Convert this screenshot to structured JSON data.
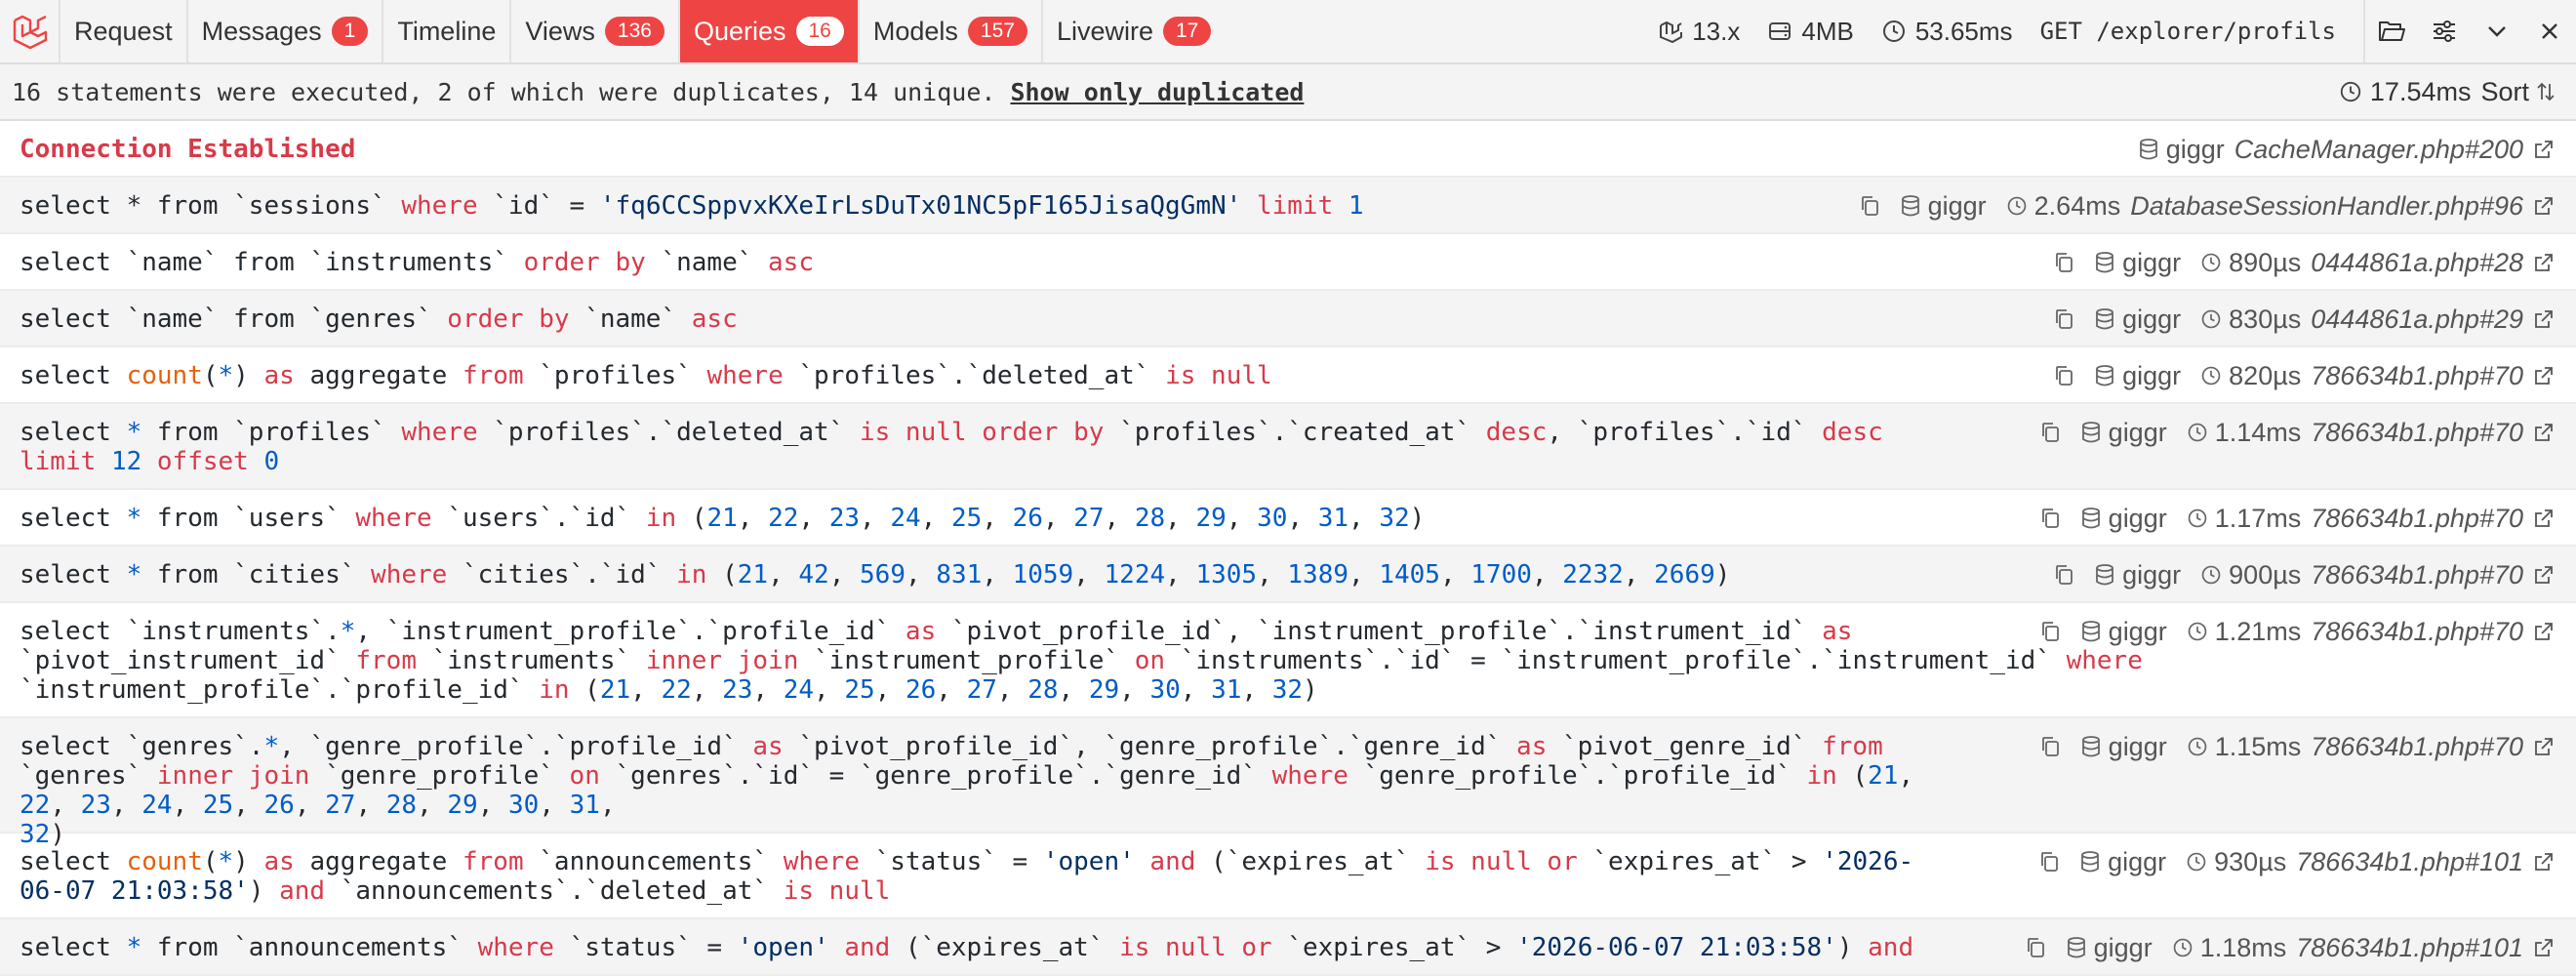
{
  "toolbar": {
    "tabs": [
      {
        "label": "Request"
      },
      {
        "label": "Messages",
        "badge": "1"
      },
      {
        "label": "Timeline"
      },
      {
        "label": "Views",
        "badge": "136"
      },
      {
        "label": "Queries",
        "badge": "16",
        "active": true
      },
      {
        "label": "Models",
        "badge": "157"
      },
      {
        "label": "Livewire",
        "badge": "17"
      }
    ],
    "laravel_version": "13.x",
    "memory": "4MB",
    "duration": "53.65ms",
    "route": "GET /explorer/profils"
  },
  "summary": {
    "text": "16 statements were executed, 2 of which were duplicates, 14 unique.",
    "link": "Show only duplicated",
    "total_time": "17.54ms",
    "sort_label": "Sort"
  },
  "rows": [
    {
      "connection": "giggr",
      "file": "CacheManager.php#200"
    },
    {
      "connection": "giggr",
      "time": "2.64ms",
      "file": "DatabaseSessionHandler.php#96"
    },
    {
      "connection": "giggr",
      "time": "890µs",
      "file": "0444861a.php#28"
    },
    {
      "connection": "giggr",
      "time": "830µs",
      "file": "0444861a.php#29"
    },
    {
      "connection": "giggr",
      "time": "820µs",
      "file": "786634b1.php#70"
    },
    {
      "connection": "giggr",
      "time": "1.14ms",
      "file": "786634b1.php#70"
    },
    {
      "connection": "giggr",
      "time": "1.17ms",
      "file": "786634b1.php#70"
    },
    {
      "connection": "giggr",
      "time": "900µs",
      "file": "786634b1.php#70"
    },
    {
      "connection": "giggr",
      "time": "1.21ms",
      "file": "786634b1.php#70"
    },
    {
      "connection": "giggr",
      "time": "1.15ms",
      "file": "786634b1.php#70"
    },
    {
      "connection": "giggr",
      "time": "930µs",
      "file": "786634b1.php#101"
    },
    {
      "connection": "giggr",
      "time": "1.18ms",
      "file": "786634b1.php#101"
    }
  ],
  "statements": [
    [
      [
        "kw",
        "Connection Established"
      ]
    ],
    [
      [
        "p",
        "select * from `sessions` "
      ],
      [
        "kw",
        "where"
      ],
      [
        "p",
        " `id` = "
      ],
      [
        "str",
        "'fq6CCSppvxKXeIrLsDuTx01NC5pF165JisaQgGmN'"
      ],
      [
        "p",
        " "
      ],
      [
        "kw",
        "limit"
      ],
      [
        "p",
        " "
      ],
      [
        "num",
        "1"
      ]
    ],
    [
      [
        "p",
        "select `name` from `instruments` "
      ],
      [
        "kw",
        "order by"
      ],
      [
        "p",
        " `name` "
      ],
      [
        "kw",
        "asc"
      ]
    ],
    [
      [
        "p",
        "select `name` from `genres` "
      ],
      [
        "kw",
        "order by"
      ],
      [
        "p",
        " `name` "
      ],
      [
        "kw",
        "asc"
      ]
    ],
    [
      [
        "p",
        "select "
      ],
      [
        "cnt",
        "count"
      ],
      [
        "p",
        "("
      ],
      [
        "num",
        "*"
      ],
      [
        "p",
        ") "
      ],
      [
        "kw",
        "as"
      ],
      [
        "p",
        " aggregate "
      ],
      [
        "kw",
        "from"
      ],
      [
        "p",
        " `profiles` "
      ],
      [
        "kw",
        "where"
      ],
      [
        "p",
        " `profiles`.`deleted_at` "
      ],
      [
        "kw",
        "is null"
      ]
    ],
    [
      [
        "p",
        "select "
      ],
      [
        "num",
        "*"
      ],
      [
        "p",
        " from `profiles` "
      ],
      [
        "kw",
        "where"
      ],
      [
        "p",
        " `profiles`.`deleted_at` "
      ],
      [
        "kw",
        "is null order by"
      ],
      [
        "p",
        " `profiles`.`created_at` "
      ],
      [
        "kw",
        "desc"
      ],
      [
        "p",
        ", `profiles`.`id` "
      ],
      [
        "kw",
        "desc"
      ],
      [
        "p",
        "\n"
      ],
      [
        "kw",
        "limit"
      ],
      [
        "p",
        " "
      ],
      [
        "num",
        "12"
      ],
      [
        "p",
        " "
      ],
      [
        "kw",
        "offset"
      ],
      [
        "p",
        " "
      ],
      [
        "num",
        "0"
      ]
    ],
    [
      [
        "p",
        "select "
      ],
      [
        "num",
        "*"
      ],
      [
        "p",
        " from `users` "
      ],
      [
        "kw",
        "where"
      ],
      [
        "p",
        " `users`.`id` "
      ],
      [
        "kw",
        "in"
      ],
      [
        "p",
        " ("
      ],
      [
        "num",
        "21"
      ],
      [
        "p",
        ", "
      ],
      [
        "num",
        "22"
      ],
      [
        "p",
        ", "
      ],
      [
        "num",
        "23"
      ],
      [
        "p",
        ", "
      ],
      [
        "num",
        "24"
      ],
      [
        "p",
        ", "
      ],
      [
        "num",
        "25"
      ],
      [
        "p",
        ", "
      ],
      [
        "num",
        "26"
      ],
      [
        "p",
        ", "
      ],
      [
        "num",
        "27"
      ],
      [
        "p",
        ", "
      ],
      [
        "num",
        "28"
      ],
      [
        "p",
        ", "
      ],
      [
        "num",
        "29"
      ],
      [
        "p",
        ", "
      ],
      [
        "num",
        "30"
      ],
      [
        "p",
        ", "
      ],
      [
        "num",
        "31"
      ],
      [
        "p",
        ", "
      ],
      [
        "num",
        "32"
      ],
      [
        "p",
        ")"
      ]
    ],
    [
      [
        "p",
        "select "
      ],
      [
        "num",
        "*"
      ],
      [
        "p",
        " from `cities` "
      ],
      [
        "kw",
        "where"
      ],
      [
        "p",
        " `cities`.`id` "
      ],
      [
        "kw",
        "in"
      ],
      [
        "p",
        " ("
      ],
      [
        "num",
        "21"
      ],
      [
        "p",
        ", "
      ],
      [
        "num",
        "42"
      ],
      [
        "p",
        ", "
      ],
      [
        "num",
        "569"
      ],
      [
        "p",
        ", "
      ],
      [
        "num",
        "831"
      ],
      [
        "p",
        ", "
      ],
      [
        "num",
        "1059"
      ],
      [
        "p",
        ", "
      ],
      [
        "num",
        "1224"
      ],
      [
        "p",
        ", "
      ],
      [
        "num",
        "1305"
      ],
      [
        "p",
        ", "
      ],
      [
        "num",
        "1389"
      ],
      [
        "p",
        ", "
      ],
      [
        "num",
        "1405"
      ],
      [
        "p",
        ", "
      ],
      [
        "num",
        "1700"
      ],
      [
        "p",
        ", "
      ],
      [
        "num",
        "2232"
      ],
      [
        "p",
        ", "
      ],
      [
        "num",
        "2669"
      ],
      [
        "p",
        ")"
      ]
    ],
    [
      [
        "p",
        "select `instruments`."
      ],
      [
        "num",
        "*"
      ],
      [
        "p",
        ", `instrument_profile`.`profile_id` "
      ],
      [
        "kw",
        "as"
      ],
      [
        "p",
        " `pivot_profile_id`, `instrument_profile`.`instrument_id` "
      ],
      [
        "kw",
        "as"
      ],
      [
        "p",
        "\n`pivot_instrument_id` "
      ],
      [
        "kw",
        "from"
      ],
      [
        "p",
        " `instruments` "
      ],
      [
        "kw",
        "inner join"
      ],
      [
        "p",
        " `instrument_profile` "
      ],
      [
        "kw",
        "on"
      ],
      [
        "p",
        " `instruments`.`id` = `instrument_profile`.`instrument_id` "
      ],
      [
        "kw",
        "where"
      ],
      [
        "p",
        "\n`instrument_profile`.`profile_id` "
      ],
      [
        "kw",
        "in"
      ],
      [
        "p",
        " ("
      ],
      [
        "num",
        "21"
      ],
      [
        "p",
        ", "
      ],
      [
        "num",
        "22"
      ],
      [
        "p",
        ", "
      ],
      [
        "num",
        "23"
      ],
      [
        "p",
        ", "
      ],
      [
        "num",
        "24"
      ],
      [
        "p",
        ", "
      ],
      [
        "num",
        "25"
      ],
      [
        "p",
        ", "
      ],
      [
        "num",
        "26"
      ],
      [
        "p",
        ", "
      ],
      [
        "num",
        "27"
      ],
      [
        "p",
        ", "
      ],
      [
        "num",
        "28"
      ],
      [
        "p",
        ", "
      ],
      [
        "num",
        "29"
      ],
      [
        "p",
        ", "
      ],
      [
        "num",
        "30"
      ],
      [
        "p",
        ", "
      ],
      [
        "num",
        "31"
      ],
      [
        "p",
        ", "
      ],
      [
        "num",
        "32"
      ],
      [
        "p",
        ")"
      ]
    ],
    [
      [
        "p",
        "select `genres`."
      ],
      [
        "num",
        "*"
      ],
      [
        "p",
        ", `genre_profile`.`profile_id` "
      ],
      [
        "kw",
        "as"
      ],
      [
        "p",
        " `pivot_profile_id`, `genre_profile`.`genre_id` "
      ],
      [
        "kw",
        "as"
      ],
      [
        "p",
        " `pivot_genre_id` "
      ],
      [
        "kw",
        "from"
      ],
      [
        "p",
        "\n`genres` "
      ],
      [
        "kw",
        "inner join"
      ],
      [
        "p",
        " `genre_profile` "
      ],
      [
        "kw",
        "on"
      ],
      [
        "p",
        " `genres`.`id` = `genre_profile`.`genre_id` "
      ],
      [
        "kw",
        "where"
      ],
      [
        "p",
        " `genre_profile`.`profile_id` "
      ],
      [
        "kw",
        "in"
      ],
      [
        "p",
        " ("
      ],
      [
        "num",
        "21"
      ],
      [
        "p",
        ", "
      ],
      [
        "num",
        "22"
      ],
      [
        "p",
        ", "
      ],
      [
        "num",
        "23"
      ],
      [
        "p",
        ", "
      ],
      [
        "num",
        "24"
      ],
      [
        "p",
        ", "
      ],
      [
        "num",
        "25"
      ],
      [
        "p",
        ", "
      ],
      [
        "num",
        "26"
      ],
      [
        "p",
        ", "
      ],
      [
        "num",
        "27"
      ],
      [
        "p",
        ", "
      ],
      [
        "num",
        "28"
      ],
      [
        "p",
        ", "
      ],
      [
        "num",
        "29"
      ],
      [
        "p",
        ", "
      ],
      [
        "num",
        "30"
      ],
      [
        "p",
        ", "
      ],
      [
        "num",
        "31"
      ],
      [
        "p",
        ",\n"
      ],
      [
        "num",
        "32"
      ],
      [
        "p",
        ")"
      ]
    ],
    [
      [
        "p",
        "select "
      ],
      [
        "cnt",
        "count"
      ],
      [
        "p",
        "("
      ],
      [
        "num",
        "*"
      ],
      [
        "p",
        ") "
      ],
      [
        "kw",
        "as"
      ],
      [
        "p",
        " aggregate "
      ],
      [
        "kw",
        "from"
      ],
      [
        "p",
        " `announcements` "
      ],
      [
        "kw",
        "where"
      ],
      [
        "p",
        " `status` = "
      ],
      [
        "str",
        "'open'"
      ],
      [
        "p",
        " "
      ],
      [
        "kw",
        "and"
      ],
      [
        "p",
        " (`expires_at` "
      ],
      [
        "kw",
        "is null or"
      ],
      [
        "p",
        " `expires_at` > "
      ],
      [
        "str",
        "'2026-\n06-07 21:03:58'"
      ],
      [
        "p",
        ") "
      ],
      [
        "kw",
        "and"
      ],
      [
        "p",
        " `announcements`.`deleted_at` "
      ],
      [
        "kw",
        "is null"
      ]
    ],
    [
      [
        "p",
        "select "
      ],
      [
        "num",
        "*"
      ],
      [
        "p",
        " from `announcements` "
      ],
      [
        "kw",
        "where"
      ],
      [
        "p",
        " `status` = "
      ],
      [
        "str",
        "'open'"
      ],
      [
        "p",
        " "
      ],
      [
        "kw",
        "and"
      ],
      [
        "p",
        " (`expires_at` "
      ],
      [
        "kw",
        "is null or"
      ],
      [
        "p",
        " `expires_at` > "
      ],
      [
        "str",
        "'2026-06-07 21:03:58'"
      ],
      [
        "p",
        ") "
      ],
      [
        "kw",
        "and"
      ]
    ]
  ]
}
